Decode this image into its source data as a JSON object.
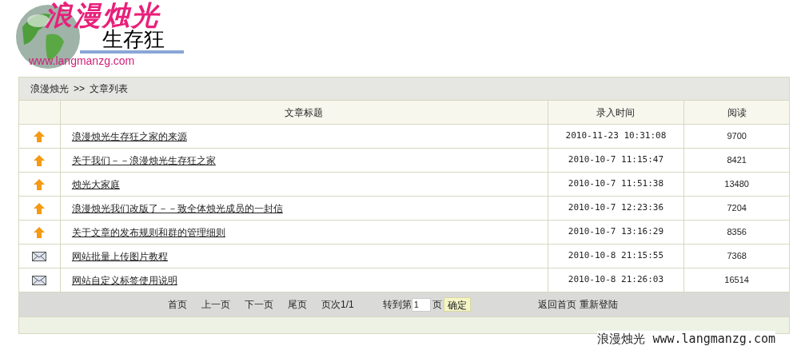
{
  "logo": {
    "title": "浪漫烛光",
    "subtitle": "生存狂",
    "url": "www.langmanzg.com"
  },
  "breadcrumb": [
    "浪漫烛光",
    ">>",
    "文章列表"
  ],
  "table": {
    "columns": [
      "",
      "文章标题",
      "录入时间",
      "阅读"
    ],
    "rows": [
      {
        "kind": "top",
        "title": "浪漫烛光生存狂之家的来源",
        "time": "2010-11-23 10:31:08",
        "reads": "9700"
      },
      {
        "kind": "top",
        "title": "关于我们－－浪漫烛光生存狂之家",
        "time": "2010-10-7 11:15:47",
        "reads": "8421"
      },
      {
        "kind": "top",
        "title": "烛光大家庭",
        "time": "2010-10-7 11:51:38",
        "reads": "13480"
      },
      {
        "kind": "top",
        "title": "浪漫烛光我们改版了－－致全体烛光成员的一封信",
        "time": "2010-10-7 12:23:36",
        "reads": "7204"
      },
      {
        "kind": "top",
        "title": "关于文章的发布规则和群的管理细则",
        "time": "2010-10-7 13:16:29",
        "reads": "8356"
      },
      {
        "kind": "mail",
        "title": "网站批量上传图片教程",
        "time": "2010-10-8 21:15:55",
        "reads": "7368"
      },
      {
        "kind": "mail",
        "title": "网站自定义标签使用说明",
        "time": "2010-10-8 21:26:03",
        "reads": "16514"
      }
    ]
  },
  "pagination": {
    "links": [
      "首页",
      "上一页",
      "下一页",
      "尾页"
    ],
    "page_info": "页次1/1",
    "goto_label": "转到第",
    "goto_value": "1",
    "goto_unit": "页",
    "goto_button": "确定",
    "extra_links": [
      "返回首页",
      "重新登陆"
    ]
  },
  "footer": "浪漫烛光 www.langmanzg.com"
}
